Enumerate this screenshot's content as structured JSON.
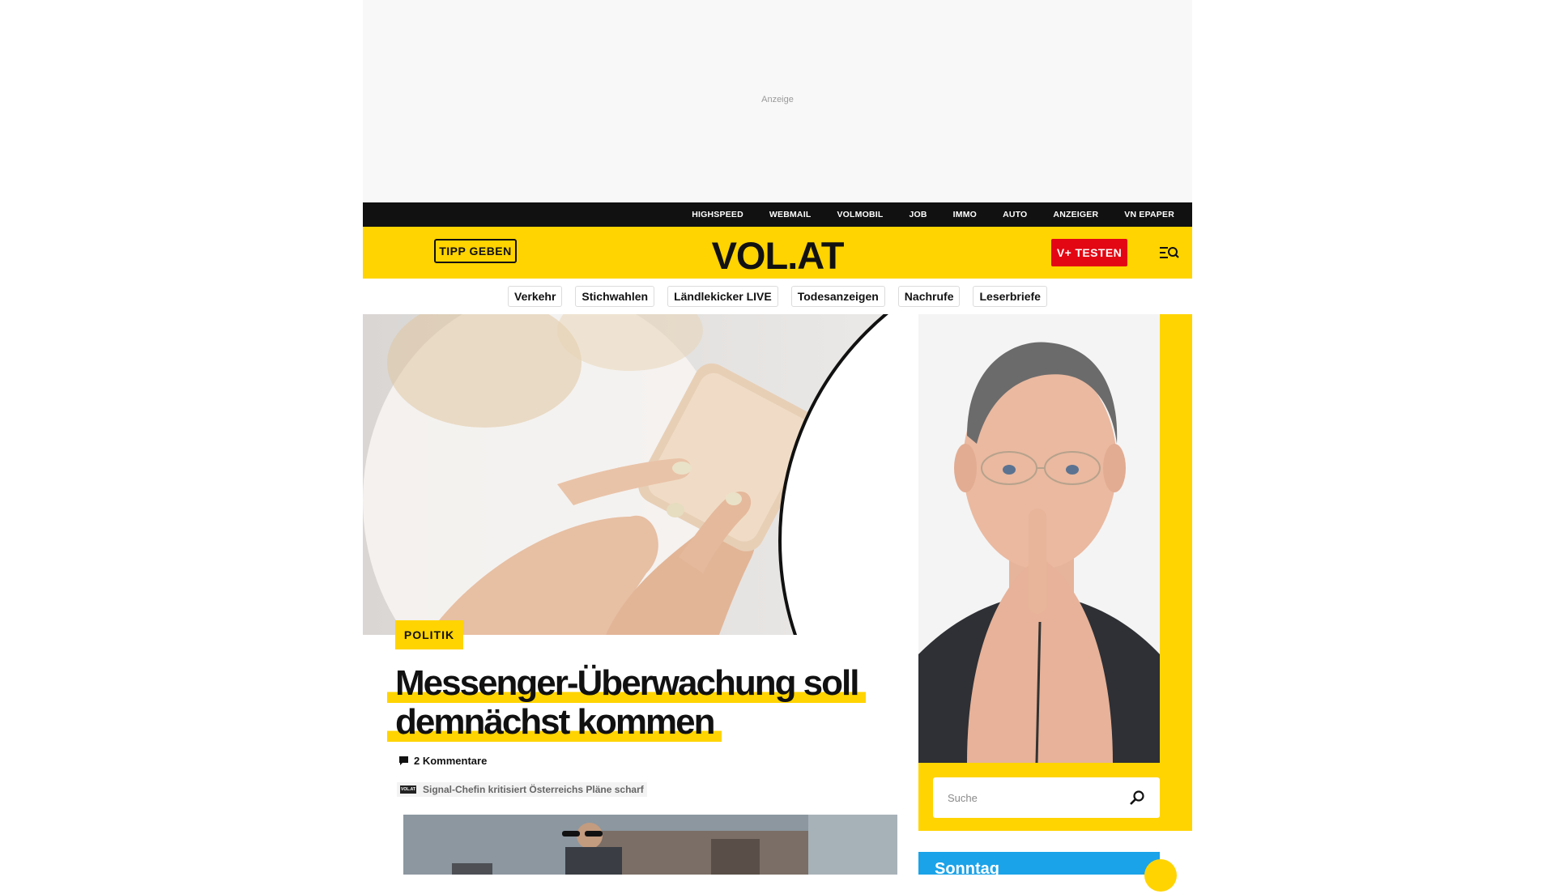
{
  "ad": {
    "label": "Anzeige"
  },
  "topbar": {
    "links": [
      "HIGHSPEED",
      "WEBMAIL",
      "VOLMOBIL",
      "JOB",
      "IMMO",
      "AUTO",
      "ANZEIGER",
      "VN EPAPER"
    ]
  },
  "header": {
    "tipp_label": "TIPP GEBEN",
    "logo": "VOL.AT",
    "vplus_label": "V+ TESTEN",
    "menu_icon": "menu-search-icon"
  },
  "tagnav": {
    "tags": [
      "Verkehr",
      "Stichwahlen",
      "Ländlekicker LIVE",
      "Todesanzeigen",
      "Nachrufe",
      "Leserbriefe"
    ]
  },
  "hero": {
    "category": "POLITIK",
    "headline_line1": "Messenger-Überwachung soll",
    "headline_line2": "demnächst kommen",
    "comments": "2 Kommentare",
    "related_logo": "VOL.AT",
    "related_text": "Signal-Chefin kritisiert Österreichs Pläne scharf"
  },
  "sidebar": {
    "search_placeholder": "Suche",
    "weather_label": "Sonntag"
  },
  "colors": {
    "brand_yellow": "#ffd400",
    "accent_red": "#e30613",
    "topbar_black": "#111111",
    "weather_blue": "#1aa3e8"
  }
}
